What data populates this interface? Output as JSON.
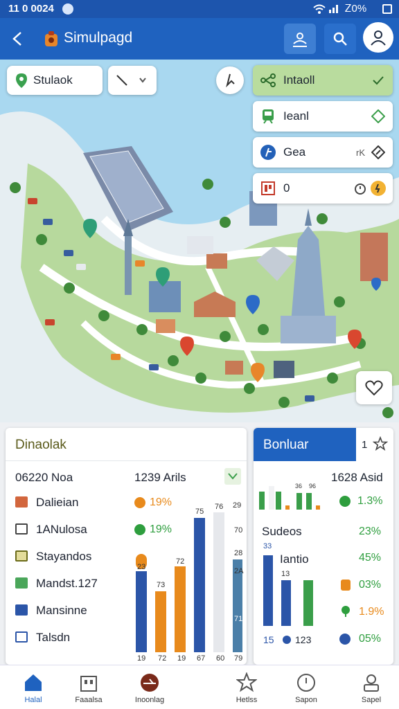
{
  "status_bar": {
    "time": "11 0 0024",
    "signal": "Ꮓ0%"
  },
  "app_bar": {
    "back_icon": "arrow-left-icon",
    "title": "Simulpagd",
    "actions": [
      "profile-swap-icon",
      "search-icon",
      "user-icon"
    ]
  },
  "map": {
    "search": {
      "value": "Stulaok"
    },
    "layers": [
      {
        "label": "Intaoll",
        "icon": "network-icon",
        "tail_icon": "check-icon",
        "selected": true
      },
      {
        "label": "Ieanl",
        "icon": "transit-icon",
        "tail_icon": "diamond-icon",
        "selected": false
      },
      {
        "label": "Gea",
        "icon": "fire-icon",
        "extra": "rK",
        "tail_icon": "diamond-edit-icon",
        "selected": false
      },
      {
        "label": "0",
        "icon": "factory-icon",
        "tail_icon": "timer-icon",
        "selected": false
      }
    ],
    "fab_icon": "heart-icon"
  },
  "left_panel": {
    "title": "Dinaolak",
    "header_left": "06220 Noa",
    "header_right": "1239 Arils",
    "rows": [
      {
        "label": "Dalieian",
        "pct": "19%",
        "pct_color": "#e88a1c"
      },
      {
        "label": "1АNulosa",
        "pct": "19%",
        "pct_color": "#2e9e3e"
      },
      {
        "label": "Stayandos",
        "pct": "",
        "pct_color": "#2e9e3e"
      },
      {
        "label": "Mandst.127",
        "pct": "",
        "pct_color": "#2e9e3e"
      },
      {
        "label": "Mansinne",
        "pct": "",
        "pct_color": "#2e9e3e"
      },
      {
        "label": "Talsdn",
        "pct": "",
        "pct_color": "#2e9e3e"
      }
    ],
    "bar_labels": [
      "23",
      "73",
      "72",
      "75",
      "76",
      "28"
    ],
    "side_labels": [
      "29",
      "70",
      "2A",
      "71"
    ],
    "axis_labels": [
      "19",
      "72",
      "19",
      "67",
      "60",
      "79"
    ]
  },
  "right_panel": {
    "title": "Bonluar",
    "count": "1",
    "header_right": "1628 Asid",
    "mini_labels": [
      "36",
      "96"
    ],
    "sub_title": "Sudeos",
    "sub_right": "23%",
    "metric_label": "Iantio",
    "bar_labels": [
      "33",
      "13"
    ],
    "rows": [
      {
        "pct": "1.3%",
        "color": "#2e9e3e"
      },
      {
        "pct": "45%",
        "color": "#2e9e3e"
      },
      {
        "pct": "03%",
        "color": "#2e9e3e"
      },
      {
        "pct": "1.9%",
        "color": "#e88a1c"
      },
      {
        "pct": "05%",
        "color": "#2e9e3e"
      }
    ],
    "bottom_left": "15",
    "bottom_mid": "123"
  },
  "nav": [
    {
      "label": "Halal",
      "icon": "home-icon",
      "active": true
    },
    {
      "label": "Faaalsa",
      "icon": "building-icon",
      "active": false
    },
    {
      "label": "Inoonlag",
      "icon": "airplane-icon",
      "active": false
    },
    {
      "label": "Hetlss",
      "icon": "star-icon",
      "active": false
    },
    {
      "label": "Sapon",
      "icon": "compass-icon",
      "active": false
    },
    {
      "label": "Sapel",
      "icon": "profile-icon",
      "active": false
    }
  ]
}
